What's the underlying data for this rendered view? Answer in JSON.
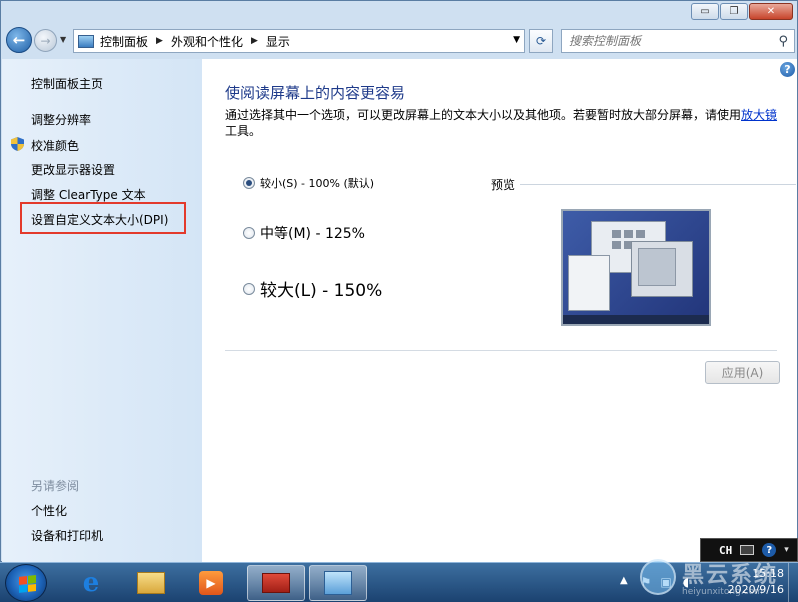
{
  "window": {
    "caption": {
      "minimize": "▭",
      "maximize": "❐",
      "close": "✕"
    }
  },
  "address": {
    "breadcrumbs": [
      "控制面板",
      "外观和个性化",
      "显示"
    ],
    "search_placeholder": "搜索控制面板"
  },
  "sidebar": {
    "home": "控制面板主页",
    "links": [
      "调整分辨率",
      "校准颜色",
      "更改显示器设置",
      "调整 ClearType 文本",
      "设置自定义文本大小(DPI)"
    ],
    "see_also_header": "另请参阅",
    "see_also": [
      "个性化",
      "设备和打印机"
    ]
  },
  "main": {
    "title": "使阅读屏幕上的内容更容易",
    "desc_before": "通过选择其中一个选项，可以更改屏幕上的文本大小以及其他项。若要暂时放大部分屏幕，请使用",
    "desc_link": "放大镜",
    "desc_after": "工具。",
    "options": [
      {
        "label": "较小(S) - 100% (默认)",
        "checked": true
      },
      {
        "label": "中等(M) - 125%",
        "checked": false
      },
      {
        "label": "较大(L) - 150%",
        "checked": false
      }
    ],
    "preview_label": "预览",
    "apply_label": "应用(A)"
  },
  "language_bar": {
    "text": "CH",
    "help": "?"
  },
  "taskbar": {
    "time": "15:18",
    "date": "2020/9/16"
  },
  "watermark": {
    "text": "黑云系统",
    "url": "heiyunxitong.com"
  },
  "colors": {
    "title_blue": "#1e3a8a",
    "link_blue": "#0033cc",
    "highlight_red": "#e33a2c"
  },
  "icons": [
    "back-icon",
    "forward-icon",
    "control-panel-icon",
    "refresh-icon",
    "search-icon",
    "help-icon",
    "shield-icon",
    "start-icon",
    "ie-icon",
    "folder-icon",
    "media-player-icon",
    "toolbox-icon",
    "control-panel-taskbar-icon"
  ]
}
